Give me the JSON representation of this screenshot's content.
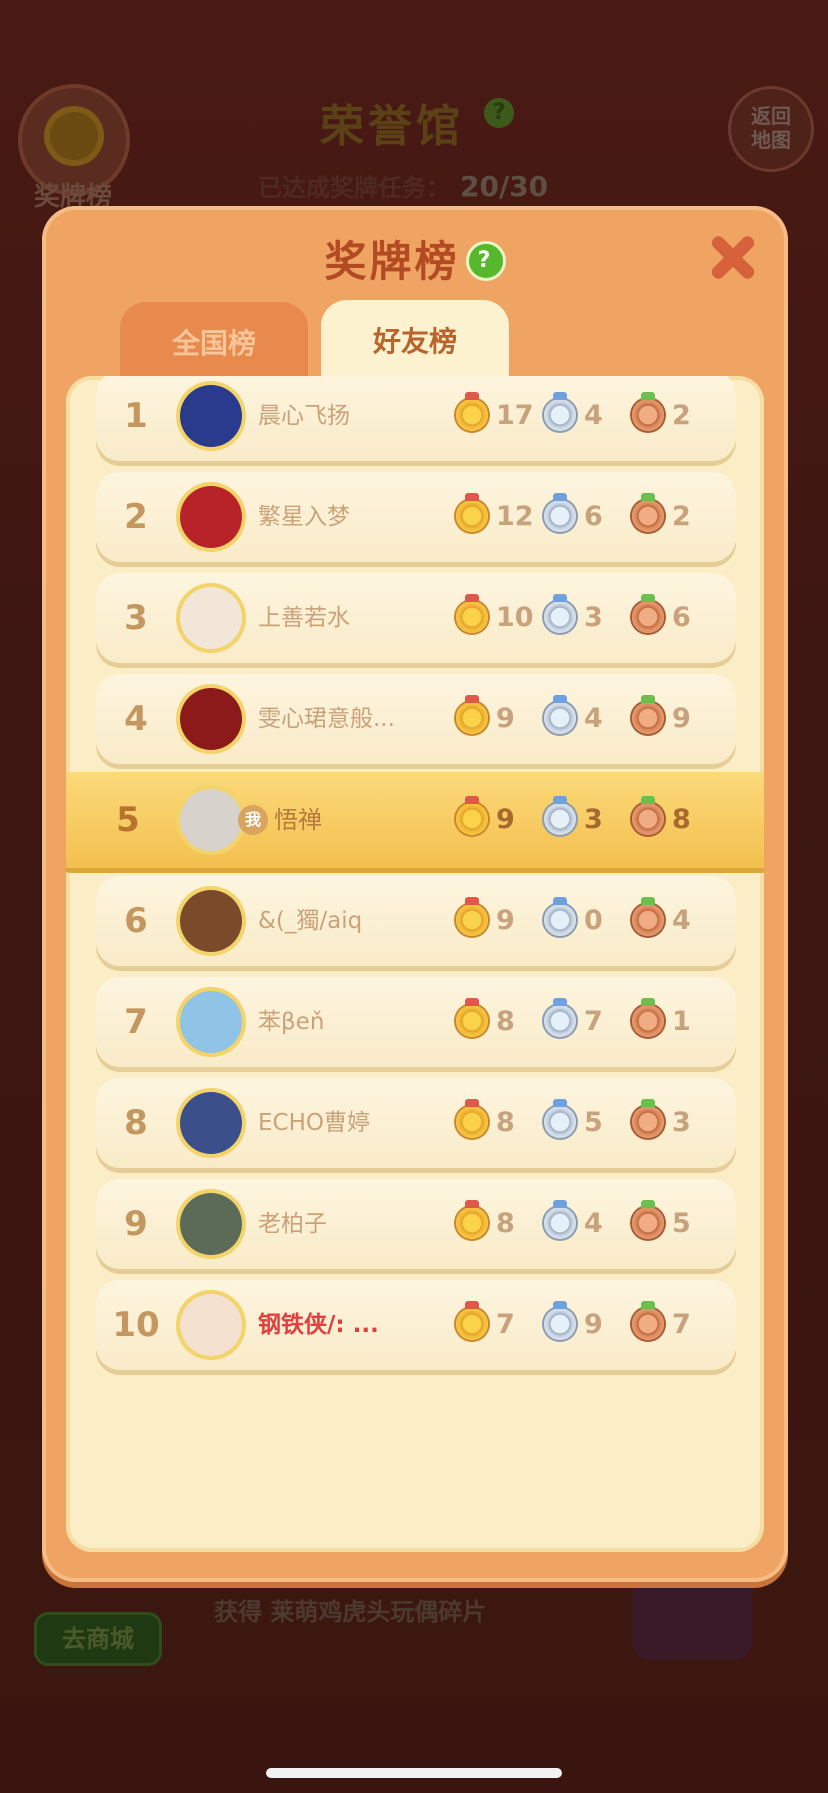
{
  "background": {
    "medal_button_label": "奖牌榜",
    "hall_title": "荣誉馆",
    "progress_label": "已达成奖牌任务：",
    "progress_value": "20/30",
    "return_button": [
      "返回",
      "地图"
    ],
    "shop_button": "去商城",
    "reward_text": "获得 莱萌鸡虎头玩偶碎片"
  },
  "modal": {
    "title": "奖牌榜",
    "help_icon": "?",
    "tabs": [
      {
        "label": "全国榜",
        "active": false
      },
      {
        "label": "好友榜",
        "active": true
      }
    ]
  },
  "me_badge": "我",
  "rows": [
    {
      "rank": "1",
      "name": "晨心飞扬",
      "gold": "17",
      "silver": "4",
      "bronze": "2",
      "avatar_color": "#2a3a8c"
    },
    {
      "rank": "2",
      "name": "繁星入梦",
      "gold": "12",
      "silver": "6",
      "bronze": "2",
      "avatar_color": "#b8232a"
    },
    {
      "rank": "3",
      "name": "上善若水",
      "gold": "10",
      "silver": "3",
      "bronze": "6",
      "avatar_color": "#f1e6d8"
    },
    {
      "rank": "4",
      "name": "雯心珺意般...",
      "gold": "9",
      "silver": "4",
      "bronze": "9",
      "avatar_color": "#8c1a1a"
    },
    {
      "rank": "5",
      "name": "悟禅",
      "gold": "9",
      "silver": "3",
      "bronze": "8",
      "avatar_color": "#d7d2cc",
      "is_me": true
    },
    {
      "rank": "6",
      "name": "&(_獨/aiq",
      "gold": "9",
      "silver": "0",
      "bronze": "4",
      "avatar_color": "#7b4a2a"
    },
    {
      "rank": "7",
      "name": "苯βеň",
      "gold": "8",
      "silver": "7",
      "bronze": "1",
      "avatar_color": "#8fc4e6"
    },
    {
      "rank": "8",
      "name": "ECHO曹婷",
      "gold": "8",
      "silver": "5",
      "bronze": "3",
      "avatar_color": "#3b4f8a"
    },
    {
      "rank": "9",
      "name": "老柏子",
      "gold": "8",
      "silver": "4",
      "bronze": "5",
      "avatar_color": "#5b6b58"
    },
    {
      "rank": "10",
      "name": "钢铁侠/: ...",
      "gold": "7",
      "silver": "9",
      "bronze": "7",
      "avatar_color": "#f3e0cf",
      "name_color": "red"
    }
  ]
}
